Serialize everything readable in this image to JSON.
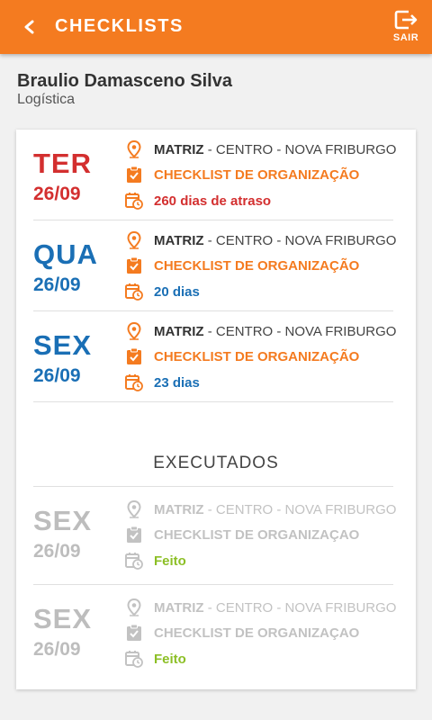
{
  "header": {
    "title": "CHECKLISTS",
    "logout_label": "SAIR"
  },
  "user": {
    "name": "Braulio Damasceno Silva",
    "department": "Logística"
  },
  "colors": {
    "accent": "#f47b20",
    "late": "#d32f2f",
    "upcoming": "#1a6fb5",
    "done_status": "#8cbf26"
  },
  "pending": [
    {
      "day": "TER",
      "date": "26/09",
      "location_strong": "MATRIZ",
      "location_rest": " - CENTRO - NOVA FRIBURGO",
      "checklist": "CHECKLIST DE ORGANIZAÇÃO",
      "status": "260 dias de atraso",
      "color": "#d32f2f"
    },
    {
      "day": "QUA",
      "date": "26/09",
      "location_strong": "MATRIZ",
      "location_rest": " - CENTRO - NOVA FRIBURGO",
      "checklist": "CHECKLIST DE ORGANIZAÇÃO",
      "status": "20 dias",
      "color": "#1a6fb5"
    },
    {
      "day": "SEX",
      "date": "26/09",
      "location_strong": "MATRIZ",
      "location_rest": " - CENTRO - NOVA FRIBURGO",
      "checklist": "CHECKLIST DE ORGANIZAÇÃO",
      "status": "23 dias",
      "color": "#1a6fb5"
    }
  ],
  "executed_title": "EXECUTADOS",
  "executed": [
    {
      "day": "SEX",
      "date": "26/09",
      "location_strong": "MATRIZ",
      "location_rest": " - CENTRO - NOVA FRIBURGO",
      "checklist": "CHECKLIST DE ORGANIZAÇAO",
      "status": "Feito"
    },
    {
      "day": "SEX",
      "date": "26/09",
      "location_strong": "MATRIZ",
      "location_rest": " - CENTRO - NOVA FRIBURGO",
      "checklist": "CHECKLIST DE ORGANIZAÇAO",
      "status": "Feito"
    }
  ]
}
